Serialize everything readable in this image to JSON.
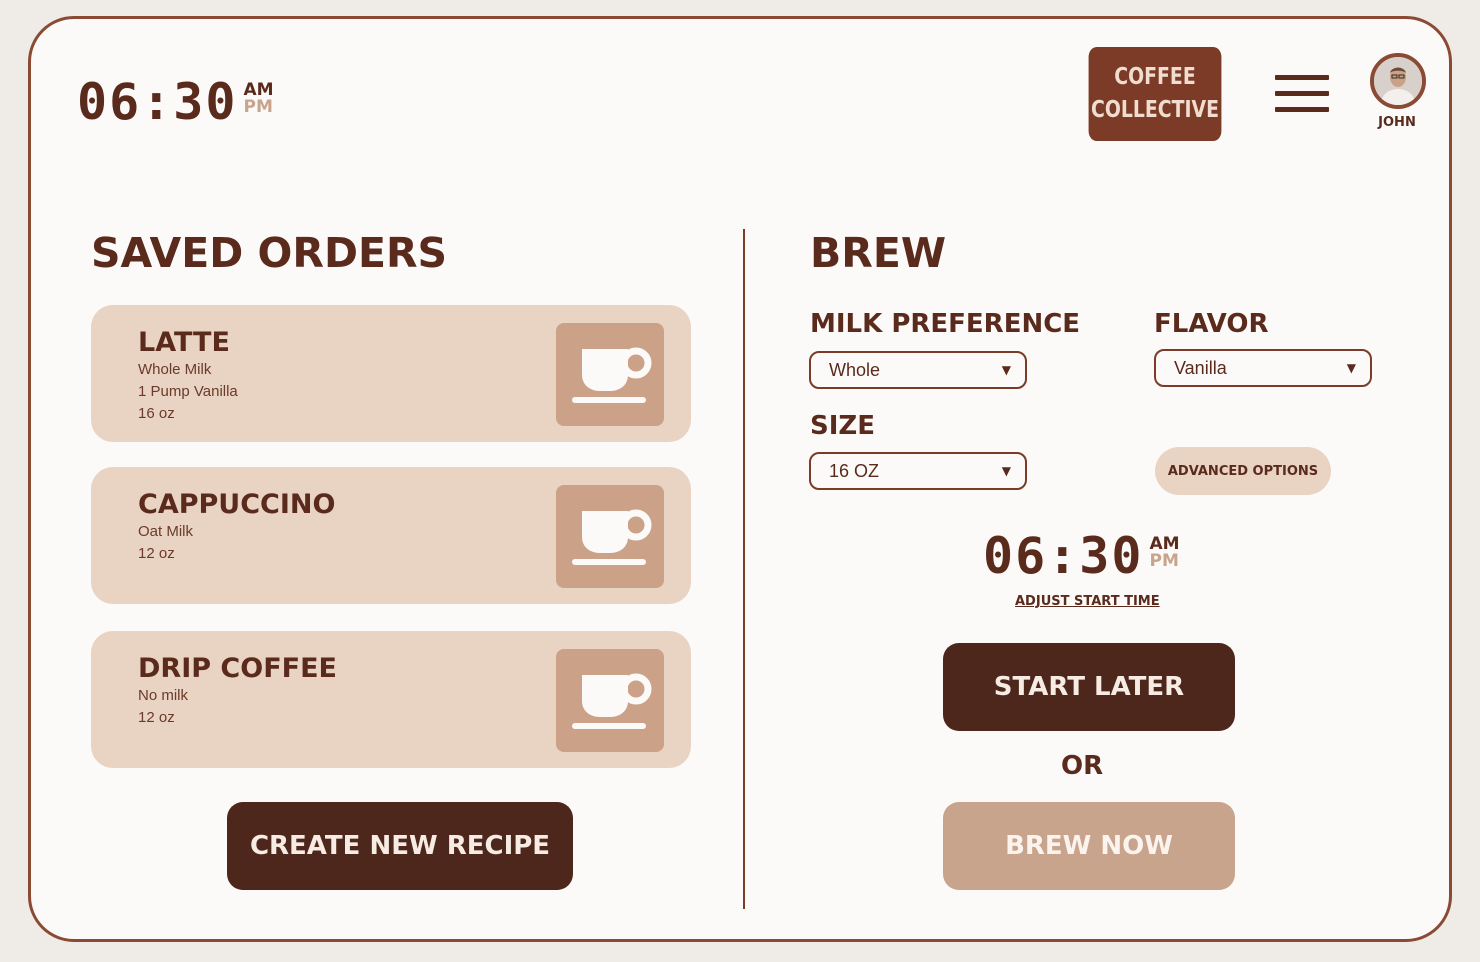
{
  "colors": {
    "brown_dark": "#4e271c",
    "brown": "#7b3b26",
    "tan": "#c8a48d",
    "card": "#e9d3c3",
    "background": "#fbfaf8"
  },
  "header": {
    "time": {
      "digits": "06:30",
      "am": "AM",
      "pm": "PM"
    },
    "brand": "COFFEE\nCOLLECTIVE",
    "menu_icon": "hamburger-menu-icon",
    "user": {
      "name": "JOHN",
      "avatar_icon": "user-avatar"
    }
  },
  "saved_orders": {
    "title": "SAVED ORDERS",
    "items": [
      {
        "name": "LATTE",
        "details": [
          "Whole Milk",
          "1 Pump Vanilla",
          "16 oz"
        ],
        "icon": "coffee-cup-icon"
      },
      {
        "name": "CAPPUCCINO",
        "details": [
          "Oat Milk",
          "12 oz"
        ],
        "icon": "coffee-cup-icon"
      },
      {
        "name": "DRIP COFFEE",
        "details": [
          "No milk",
          "12 oz"
        ],
        "icon": "coffee-cup-icon"
      }
    ],
    "create_button": "CREATE NEW RECIPE"
  },
  "brew": {
    "title": "BREW",
    "milk": {
      "label": "MILK PREFERENCE",
      "value": "Whole"
    },
    "flavor": {
      "label": "FLAVOR",
      "value": "Vanilla"
    },
    "size": {
      "label": "SIZE",
      "value": "16 OZ"
    },
    "advanced_button": "ADVANCED OPTIONS",
    "start_time": {
      "digits": "06:30",
      "am": "AM",
      "pm": "PM"
    },
    "adjust_link": "ADJUST START TIME",
    "start_later_button": "START LATER",
    "or_text": "OR",
    "brew_now_button": "BREW NOW",
    "dropdown_arrow": "▼"
  }
}
